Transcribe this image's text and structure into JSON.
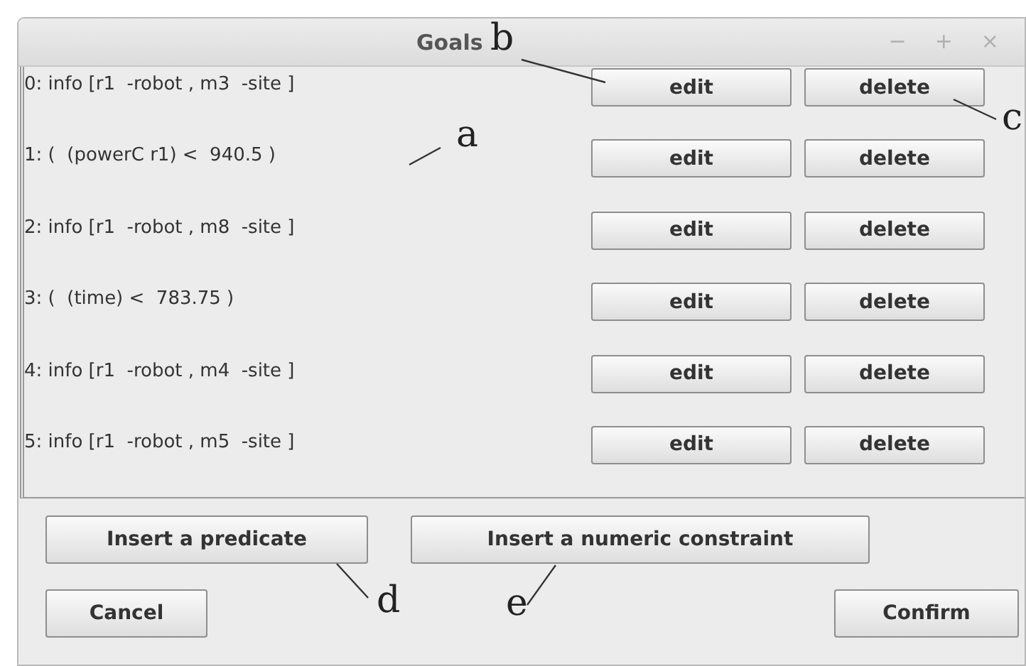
{
  "window": {
    "title": "Goals",
    "controls": [
      "−",
      "+",
      "×"
    ]
  },
  "goals": [
    {
      "text": "0: info [r1  -robot , m3  -site ]",
      "edit": "edit",
      "delete": "delete"
    },
    {
      "text": "1: (  (powerC r1) <  940.5 )",
      "edit": "edit",
      "delete": "delete"
    },
    {
      "text": "2: info [r1  -robot , m8  -site ]",
      "edit": "edit",
      "delete": "delete"
    },
    {
      "text": "3: (  (time) <  783.75 )",
      "edit": "edit",
      "delete": "delete"
    },
    {
      "text": "4: info [r1  -robot , m4  -site ]",
      "edit": "edit",
      "delete": "delete"
    },
    {
      "text": "5: info [r1  -robot , m5  -site ]",
      "edit": "edit",
      "delete": "delete"
    }
  ],
  "insert_buttons": [
    "Insert a predicate",
    "Insert a numeric constraint"
  ],
  "cancel_button": "Cancel",
  "confirm_button": "Confirm",
  "callouts": [
    {
      "label": "a"
    },
    {
      "label": "b"
    },
    {
      "label": "c"
    },
    {
      "label": "d"
    },
    {
      "label": "e"
    }
  ]
}
